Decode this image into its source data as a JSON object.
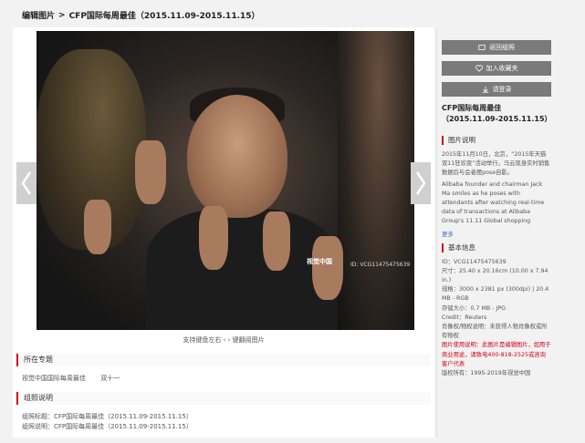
{
  "breadcrumb": {
    "root": "编辑图片",
    "sep": ">",
    "current": "CFP国际每周最佳（2015.11.09-2015.11.15）"
  },
  "photo": {
    "watermark": "视觉中国",
    "image_id": "ID: VCG11475475639"
  },
  "keyboard_hint": "支持键盘左右 ‹  › 键翻阅图片",
  "section_topic": {
    "heading": "所在专题",
    "items": [
      "视觉中国国际每周最佳",
      "双十一"
    ]
  },
  "section_group": {
    "heading": "组照说明",
    "title_line": "组照标题：CFP国际每周最佳（2015.11.09-2015.11.15）",
    "desc_line": "组照说明：CFP国际每周最佳（2015.11.09-2015.11.15）"
  },
  "sidebar": {
    "btn_back": "返回组照",
    "btn_fav": "加入收藏夹",
    "btn_login": "请登录",
    "title": "CFP国际每周最佳（2015.11.09-2015.11.15）",
    "caption_heading": "图片说明",
    "caption_cn": "2015年11月10日，北京，“2015年天猫双11狂欢夜”活动举行，马云现身实时销售数据后与会者摆pose自影。",
    "caption_en": "Alibaba founder and chairman Jack Ma smiles as he poses with attendants after watching real-time data of transactions at Alibaba Group's 11.11 Global shopping",
    "more": "更多",
    "info_heading": "基本信息",
    "info": {
      "id": "ID：VCG11475475639",
      "size": "尺寸：25.40 x 20.16cm (10.00 x 7.94 in.)",
      "spec": "规格：3000 x 2381 px (300dpi) | 20.4 MB - RGB",
      "storage": "存储大小：0.7 MB - JPG",
      "credit": "Credit：Reuters",
      "rights": "肖像权/物权说明：未获得人物肖像权或所有物权",
      "usage": "图片使用说明：此图片是编辑图片，如用于商业用途，请致电400-818-2525或咨询客户代表",
      "copyright": "版权所有：1995-2019年视觉中国"
    }
  },
  "colors": {
    "accent": "#d0021b",
    "button_bg": "#7a7a7a",
    "link": "#3a6fc4"
  }
}
